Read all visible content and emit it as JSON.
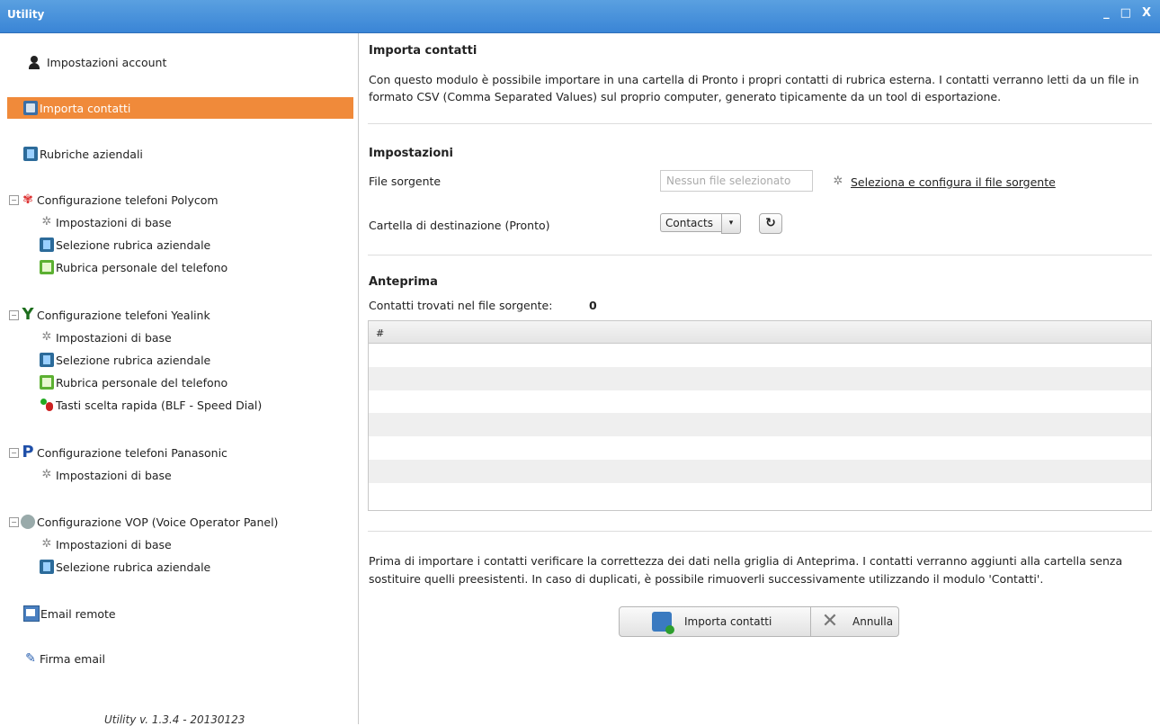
{
  "window": {
    "title": "Utility",
    "minimize": "_",
    "maximize": "□",
    "close": "X"
  },
  "sidebar": {
    "account": "Impostazioni account",
    "import": "Importa contatti",
    "rubriche": "Rubriche aziendali",
    "polycom": {
      "title": "Configurazione telefoni Polycom",
      "children": [
        "Impostazioni di base",
        "Selezione rubrica aziendale",
        "Rubrica personale del telefono"
      ]
    },
    "yealink": {
      "title": "Configurazione telefoni Yealink",
      "children": [
        "Impostazioni di base",
        "Selezione rubrica aziendale",
        "Rubrica personale del telefono",
        "Tasti scelta rapida (BLF - Speed Dial)"
      ]
    },
    "panasonic": {
      "title": "Configurazione telefoni Panasonic",
      "children": [
        "Impostazioni di base"
      ]
    },
    "vop": {
      "title": "Configurazione VOP (Voice Operator Panel)",
      "children": [
        "Impostazioni di base",
        "Selezione rubrica aziendale"
      ]
    },
    "email_remote": "Email remote",
    "firma": "Firma email",
    "version": "Utility v. 1.3.4 - 20130123"
  },
  "main": {
    "title": "Importa contatti",
    "description": "Con questo modulo è possibile importare in una cartella di Pronto i propri contatti di rubrica esterna. I contatti verranno letti da un file in formato CSV (Comma Separated Values) sul proprio computer, generato tipicamente da un tool di esportazione.",
    "settings_title": "Impostazioni",
    "file_label": "File sorgente",
    "file_placeholder": "Nessun file selezionato",
    "select_link": "Seleziona e configura il file sorgente",
    "dest_label": "Cartella di destinazione (Pronto)",
    "dest_value": "Contacts",
    "preview_title": "Anteprima",
    "found_label": "Contatti trovati nel file sorgente:",
    "found_count": "0",
    "grid_header": "#",
    "footer": "Prima di importare i contatti verificare la correttezza dei dati nella griglia di Anteprima. I contatti verranno aggiunti alla cartella senza sostituire quelli preesistenti. In caso di duplicati, è possibile rimuoverli successivamente utilizzando il modulo 'Contatti'.",
    "import_button": "Importa contatti",
    "cancel_button": "Annulla"
  },
  "colors": {
    "titlebar": "#3a85d6",
    "selected": "#f08a3a"
  }
}
